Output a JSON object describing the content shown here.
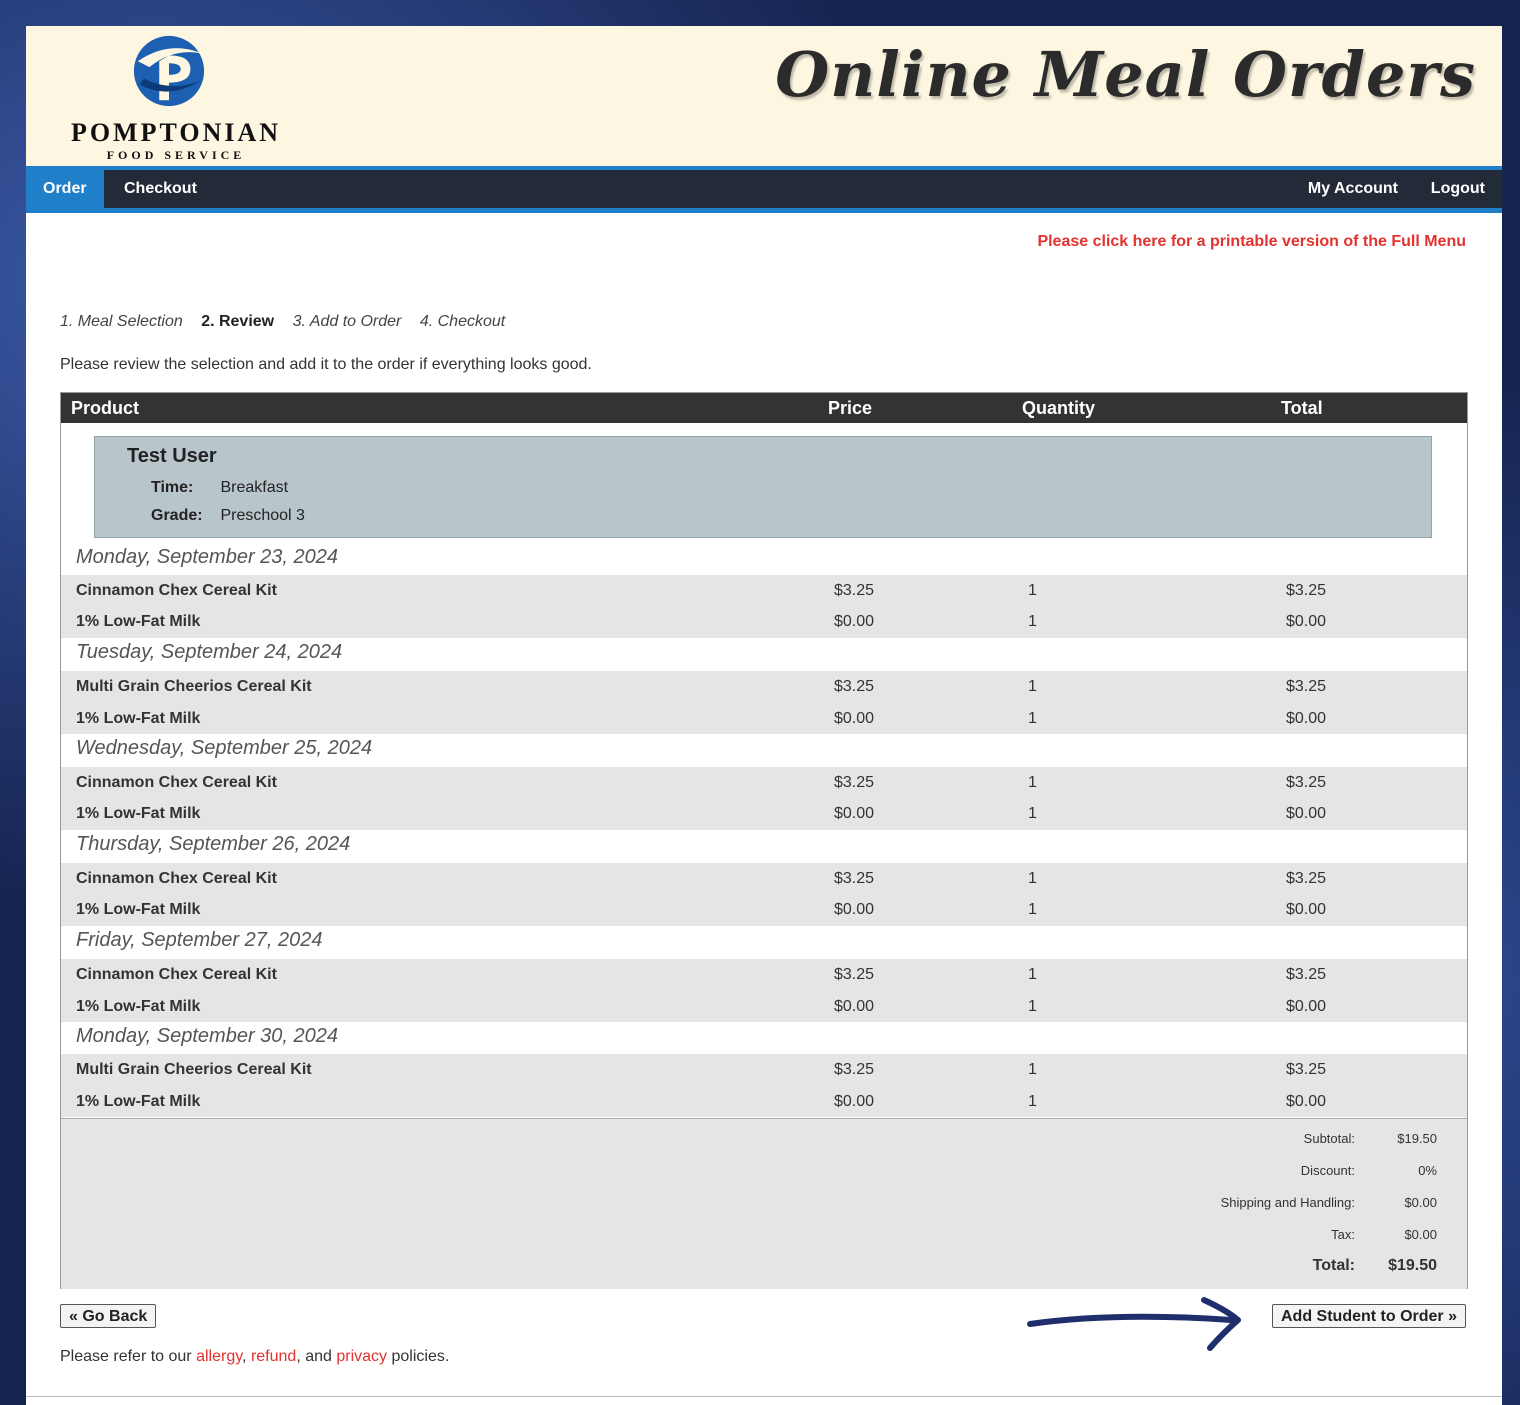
{
  "header": {
    "brand_name": "POMPTONIAN",
    "brand_sub": "FOOD SERVICE",
    "site_title": "Online Meal Orders"
  },
  "nav": {
    "order": "Order",
    "checkout": "Checkout",
    "my_account": "My Account",
    "logout": "Logout"
  },
  "print_link": "Please click here for a printable version of the Full Menu",
  "steps": [
    "1. Meal Selection",
    "2. Review",
    "3. Add to Order",
    "4. Checkout"
  ],
  "intro": "Please review the selection and add it to the order if everything looks good.",
  "table": {
    "headers": {
      "product": "Product",
      "price": "Price",
      "quantity": "Quantity",
      "total": "Total"
    }
  },
  "student": {
    "name": "Test User",
    "time_label": "Time:",
    "time_value": "Breakfast",
    "grade_label": "Grade:",
    "grade_value": "Preschool 3"
  },
  "days": [
    {
      "date": "Monday, September 23, 2024",
      "items": [
        {
          "product": "Cinnamon Chex Cereal Kit",
          "price": "$3.25",
          "qty": "1",
          "total": "$3.25"
        },
        {
          "product": "1% Low-Fat Milk",
          "price": "$0.00",
          "qty": "1",
          "total": "$0.00"
        }
      ]
    },
    {
      "date": "Tuesday, September 24, 2024",
      "items": [
        {
          "product": "Multi Grain Cheerios Cereal Kit",
          "price": "$3.25",
          "qty": "1",
          "total": "$3.25"
        },
        {
          "product": "1% Low-Fat Milk",
          "price": "$0.00",
          "qty": "1",
          "total": "$0.00"
        }
      ]
    },
    {
      "date": "Wednesday, September 25, 2024",
      "items": [
        {
          "product": "Cinnamon Chex Cereal Kit",
          "price": "$3.25",
          "qty": "1",
          "total": "$3.25"
        },
        {
          "product": "1% Low-Fat Milk",
          "price": "$0.00",
          "qty": "1",
          "total": "$0.00"
        }
      ]
    },
    {
      "date": "Thursday, September 26, 2024",
      "items": [
        {
          "product": "Cinnamon Chex Cereal Kit",
          "price": "$3.25",
          "qty": "1",
          "total": "$3.25"
        },
        {
          "product": "1% Low-Fat Milk",
          "price": "$0.00",
          "qty": "1",
          "total": "$0.00"
        }
      ]
    },
    {
      "date": "Friday, September 27, 2024",
      "items": [
        {
          "product": "Cinnamon Chex Cereal Kit",
          "price": "$3.25",
          "qty": "1",
          "total": "$3.25"
        },
        {
          "product": "1% Low-Fat Milk",
          "price": "$0.00",
          "qty": "1",
          "total": "$0.00"
        }
      ]
    },
    {
      "date": "Monday, September 30, 2024",
      "items": [
        {
          "product": "Multi Grain Cheerios Cereal Kit",
          "price": "$3.25",
          "qty": "1",
          "total": "$3.25"
        },
        {
          "product": "1% Low-Fat Milk",
          "price": "$0.00",
          "qty": "1",
          "total": "$0.00"
        }
      ]
    }
  ],
  "totals": {
    "subtotal_label": "Subtotal:",
    "subtotal": "$19.50",
    "discount_label": "Discount:",
    "discount": "0%",
    "shipping_label": "Shipping and Handling:",
    "shipping": "$0.00",
    "tax_label": "Tax:",
    "tax": "$0.00",
    "total_label": "Total:",
    "total": "$19.50"
  },
  "buttons": {
    "go_back": "« Go Back",
    "add_student": "Add Student to Order »"
  },
  "policies": {
    "prefix": "Please refer to our",
    "allergy": "allergy",
    "comma1": ",",
    "refund": "refund",
    "and": ", and",
    "privacy": "privacy",
    "suffix": "policies."
  },
  "colors": {
    "accent_blue": "#1f7fc8",
    "nav_dark": "#232a38",
    "link_red": "#e2332f",
    "header_cream": "#fdf6e1",
    "student_band": "#b8c6cb",
    "annotation_arrow": "#1e2f6b"
  }
}
